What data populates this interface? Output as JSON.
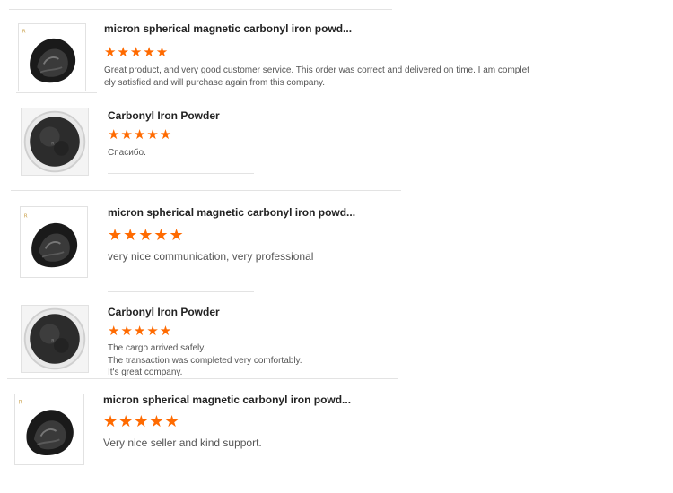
{
  "reviews": [
    {
      "product": "micron spherical magnetic carbonyl iron powd...",
      "rating": 5,
      "stars": "★★★★★",
      "image": "black-powder-pile",
      "text_lines": [
        "Great product, and very good customer service. This order was correct and delivered on time. I am complet",
        "ely satisfied and will purchase again from this company."
      ]
    },
    {
      "product": "Carbonyl Iron Powder",
      "rating": 5,
      "stars": "★★★★★",
      "image": "powder-in-dish",
      "text_lines": [
        "Спасибо."
      ]
    },
    {
      "product": "micron spherical magnetic carbonyl iron powd...",
      "rating": 5,
      "stars": "★★★★★",
      "image": "black-powder-pile",
      "text_lines": [
        "very nice communication, very professional"
      ]
    },
    {
      "product": "Carbonyl Iron Powder",
      "rating": 5,
      "stars": "★★★★★",
      "image": "powder-in-dish",
      "text_lines": [
        "The cargo arrived safely.",
        "The transaction was completed very comfortably.",
        "It's great company."
      ]
    },
    {
      "product": "micron spherical magnetic carbonyl iron powd...",
      "rating": 5,
      "stars": "★★★★★",
      "image": "black-powder-pile",
      "text_lines": [
        "Very nice seller and kind support."
      ]
    }
  ],
  "colors": {
    "star": "#ff6a00",
    "divider": "#e3e3e3"
  }
}
